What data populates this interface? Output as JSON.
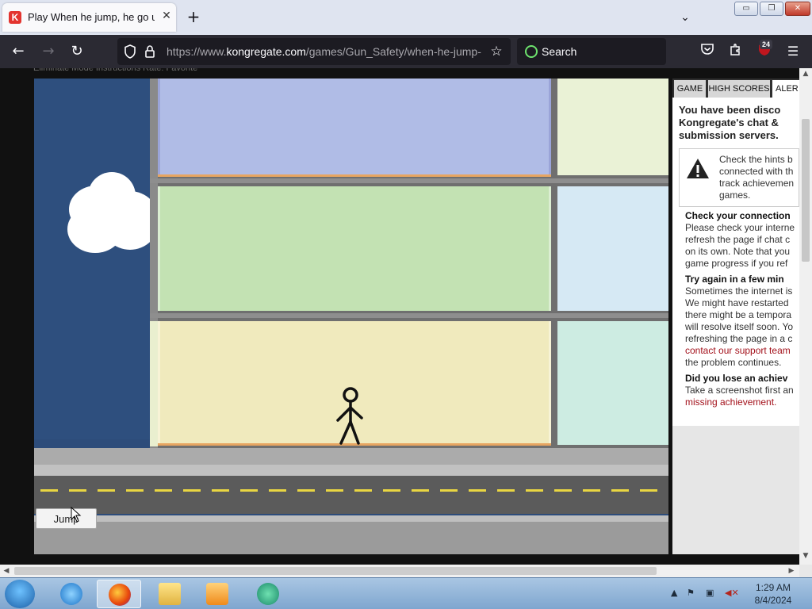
{
  "browser": {
    "tab": {
      "favicon_letter": "K",
      "title": "Play When he jump, he go up h",
      "close_glyph": "✕"
    },
    "new_tab_glyph": "+",
    "list_tabs_glyph": "⌄",
    "window_buttons": {
      "min": "▭",
      "max": "❐",
      "close": "✕"
    },
    "nav": {
      "back": "←",
      "forward": "→",
      "reload": "↻",
      "url_prefix": "https://www.",
      "url_host": "kongregate.com",
      "url_path": "/games/Gun_Safety/when-he-jump-",
      "search_label": "Search",
      "extension_badge": "24"
    },
    "icons": [
      "shield-icon",
      "lock-icon",
      "bookmark-star-icon",
      "pocket-icon",
      "extensions-icon",
      "ublock-icon",
      "menu-icon"
    ]
  },
  "page": {
    "top_strip_text": "Eliminate Mode   Instructions   Rate:   Favorite"
  },
  "game": {
    "jump_button_label": "Jump",
    "colors": {
      "sky": "#2e4f7e",
      "floor_top": "#b0bce6",
      "floor_mid": "#c3e2b3",
      "floor_bottom": "#f0eabd",
      "road": "#5b5b5b",
      "road_dash": "#e9d642"
    }
  },
  "panel": {
    "tabs": [
      "GAME",
      "HIGH SCORES",
      "ALER"
    ],
    "heading_lines": [
      "You have been disco",
      "Kongregate's chat &",
      "submission servers."
    ],
    "warning_lines": [
      "Check the hints b",
      "connected with th",
      "track achievemen",
      "games."
    ],
    "sections": [
      {
        "title": "Check your connection",
        "lines": [
          "Please check your interne",
          "refresh the page if chat c",
          "on its own. Note that you",
          "game progress if you ref"
        ]
      },
      {
        "title": "Try again in a few min",
        "lines": [
          "Sometimes the internet is",
          "We might have restarted",
          "there might be a tempora",
          "will resolve itself soon. Yo",
          "refreshing the page in a c"
        ],
        "link": "contact our support team",
        "after_link": "the problem continues."
      },
      {
        "title": "Did you lose an achiev",
        "lines": [
          "Take a screenshot first an"
        ],
        "link": "missing achievement."
      }
    ]
  },
  "taskbar": {
    "time": "1:29 AM",
    "date": "8/4/2024"
  }
}
